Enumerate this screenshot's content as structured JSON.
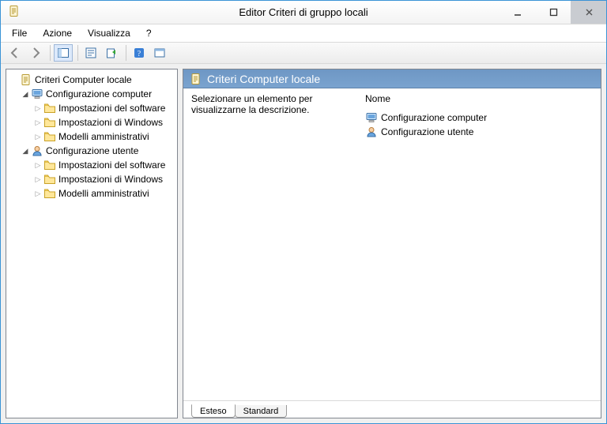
{
  "window": {
    "title": "Editor Criteri di gruppo locali"
  },
  "menu": {
    "file": "File",
    "action": "Azione",
    "view": "Visualizza",
    "help": "?"
  },
  "tree": {
    "root": "Criteri Computer locale",
    "computer": "Configurazione computer",
    "user": "Configurazione utente",
    "software": "Impostazioni del software",
    "windows": "Impostazioni di Windows",
    "templates": "Modelli amministrativi"
  },
  "detail": {
    "title": "Criteri Computer locale",
    "hint": "Selezionare un elemento per visualizzarne la descrizione.",
    "col_name": "Nome",
    "items": {
      "computer": "Configurazione computer",
      "user": "Configurazione utente"
    }
  },
  "tabs": {
    "extended": "Esteso",
    "standard": "Standard"
  }
}
